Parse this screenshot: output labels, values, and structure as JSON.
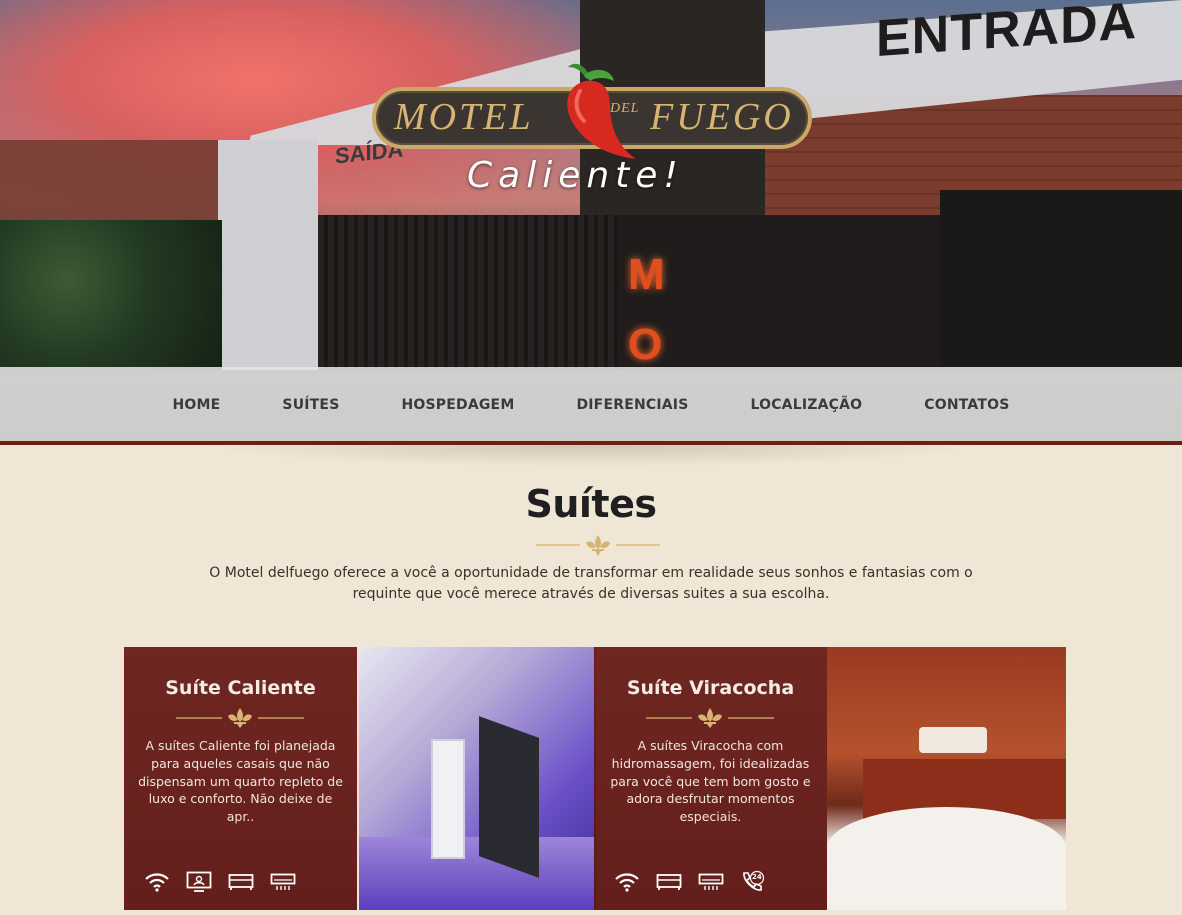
{
  "hero": {
    "sign_entrada": "ENTRADA",
    "sign_saida": "SAÍDA",
    "neon_text": "M O"
  },
  "logo": {
    "motel": "MOTEL",
    "del": "DEL",
    "fuego": "FUEGO",
    "tagline": "Caliente!"
  },
  "nav": {
    "items": [
      {
        "label": "HOME"
      },
      {
        "label": "SUÍTES"
      },
      {
        "label": "HOSPEDAGEM"
      },
      {
        "label": "DIFERENCIAIS"
      },
      {
        "label": "LOCALIZAÇÃO"
      },
      {
        "label": "CONTATOS"
      }
    ]
  },
  "section": {
    "title": "Suítes",
    "description": "O Motel delfuego oferece a você a oportunidade de transformar em realidade seus sonhos e fantasias com o requinte que você merece através de diversas suites a sua escolha."
  },
  "cards": [
    {
      "title": "Suíte Caliente",
      "description": "A suítes Caliente foi planejada para aqueles casais que não dispensam um quarto repleto de luxo e conforto. Não deixe de apr..",
      "icons": [
        "wifi-icon",
        "tv-icon",
        "bed-icon",
        "air-conditioner-icon"
      ]
    },
    {
      "title": "Suíte Viracocha",
      "description": "A suítes Viracocha com hidromassagem, foi idealizadas para você que tem bom gosto e adora desfrutar momentos especiais.",
      "icons": [
        "wifi-icon",
        "bed-icon",
        "air-conditioner-icon",
        "phone-24h-icon"
      ],
      "phone_badge": "24"
    }
  ],
  "colors": {
    "accent_dark_red": "#6e1e14",
    "card_panel": "#661814",
    "background_cream": "#efe6d6",
    "ornament_gold": "#d7b472"
  }
}
